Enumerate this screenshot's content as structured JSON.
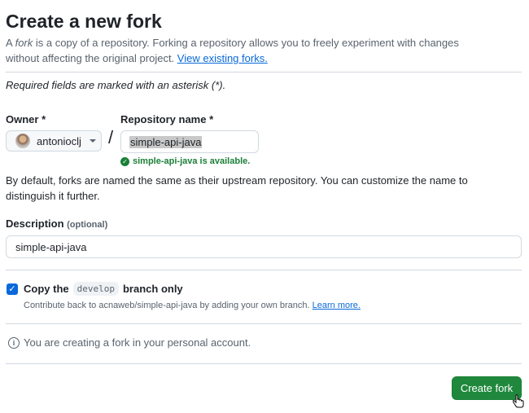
{
  "page": {
    "title": "Create a new fork",
    "intro_prefix": "A ",
    "intro_fork_word": "fork",
    "intro_rest": " is a copy of a repository. Forking a repository allows you to freely experiment with changes without affecting the original project. ",
    "view_forks_link": "View existing forks.",
    "required_note": "Required fields are marked with an asterisk (*)."
  },
  "owner": {
    "label": "Owner *",
    "selected": "antonioclj"
  },
  "repository": {
    "label": "Repository name *",
    "value": "simple-api-java",
    "availability": "simple-api-java is available."
  },
  "separator": "/",
  "default_note": "By default, forks are named the same as their upstream repository. You can customize the name to distinguish it further.",
  "description": {
    "label": "Description",
    "optional": "(optional)",
    "value": "simple-api-java"
  },
  "copy_branch": {
    "checked": true,
    "label_prefix": "Copy the",
    "branch": "develop",
    "label_suffix": "branch only",
    "sub_text": "Contribute back to acnaweb/simple-api-java by adding your own branch. ",
    "learn_more": "Learn more."
  },
  "info_text": "You are creating a fork in your personal account.",
  "create_button": "Create fork",
  "colors": {
    "primary_button": "#1f883d",
    "link": "#0969da",
    "success": "#1a7f37"
  }
}
